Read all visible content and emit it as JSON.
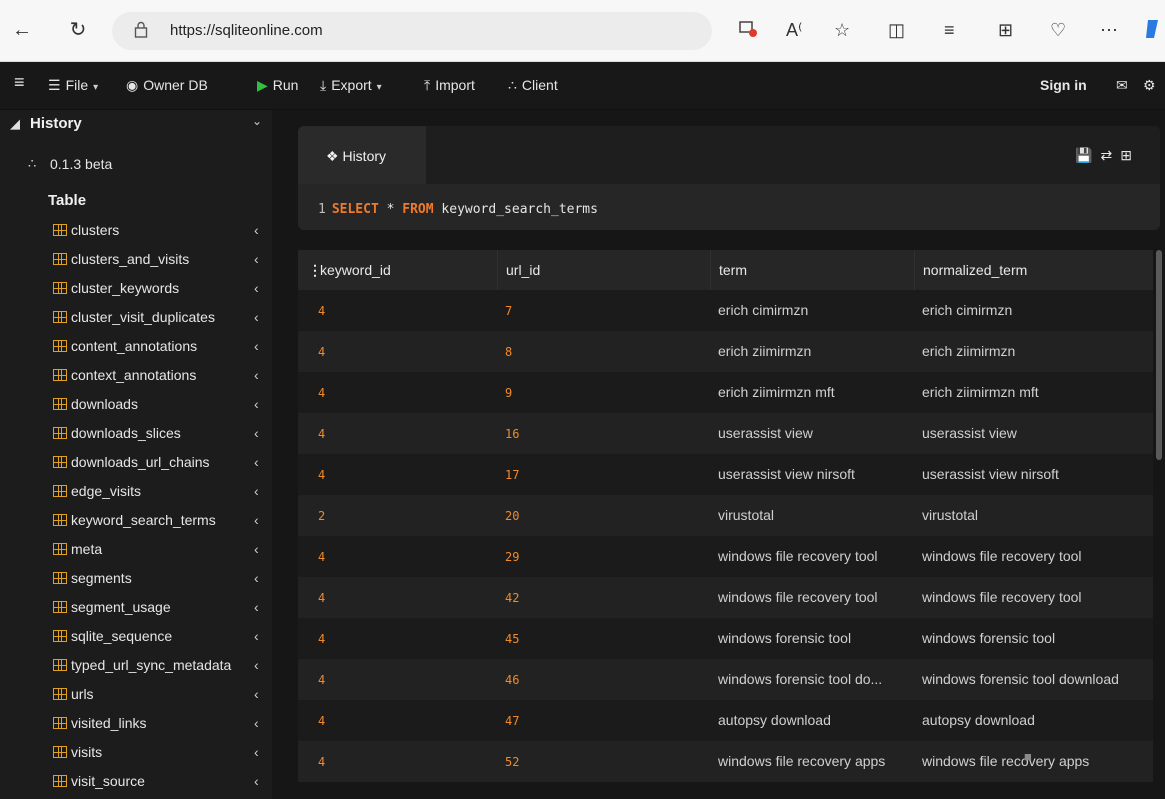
{
  "browser": {
    "url": "https://sqliteonline.com",
    "icons": [
      "back-icon",
      "reload-icon",
      "lock-icon",
      "extension-icon",
      "read-aloud-icon",
      "favorite-icon",
      "split-screen-icon",
      "favorites-list-icon",
      "collections-icon",
      "performance-icon",
      "more-icon",
      "copilot-icon"
    ]
  },
  "toolbar": {
    "file": "File",
    "owner_db": "Owner DB",
    "run": "Run",
    "export": "Export",
    "import": "Import",
    "client": "Client",
    "sign_in": "Sign in"
  },
  "sidebar": {
    "history": "History",
    "version": "0.1.3 beta",
    "table_heading": "Table",
    "tables": [
      "clusters",
      "clusters_and_visits",
      "cluster_keywords",
      "cluster_visit_duplicates",
      "content_annotations",
      "context_annotations",
      "downloads",
      "downloads_slices",
      "downloads_url_chains",
      "edge_visits",
      "keyword_search_terms",
      "meta",
      "segments",
      "segment_usage",
      "sqlite_sequence",
      "typed_url_sync_metadata",
      "urls",
      "visited_links",
      "visits",
      "visit_source"
    ]
  },
  "editor": {
    "tab": "History",
    "line_number": "1",
    "kw_select": "SELECT",
    "star": "*",
    "kw_from": "FROM",
    "table": "keyword_search_terms"
  },
  "results": {
    "columns": [
      "keyword_id",
      "url_id",
      "term",
      "normalized_term"
    ],
    "rows": [
      [
        "4",
        "7",
        "erich cimirmzn",
        "erich cimirmzn"
      ],
      [
        "4",
        "8",
        "erich ziimirmzn",
        "erich ziimirmzn"
      ],
      [
        "4",
        "9",
        "erich ziimirmzn mft",
        "erich ziimirmzn mft"
      ],
      [
        "4",
        "16",
        "userassist view",
        "userassist view"
      ],
      [
        "4",
        "17",
        "userassist view nirsoft",
        "userassist view nirsoft"
      ],
      [
        "2",
        "20",
        "virustotal",
        "virustotal"
      ],
      [
        "4",
        "29",
        "windows file recovery tool",
        "windows file recovery tool"
      ],
      [
        "4",
        "42",
        "windows file recovery tool",
        "windows file recovery tool"
      ],
      [
        "4",
        "45",
        "windows forensic tool",
        "windows forensic tool"
      ],
      [
        "4",
        "46",
        "windows forensic tool do...",
        "windows forensic tool download"
      ],
      [
        "4",
        "47",
        "autopsy download",
        "autopsy download"
      ],
      [
        "4",
        "52",
        "windows file recovery apps",
        "windows file recovery apps"
      ]
    ]
  }
}
